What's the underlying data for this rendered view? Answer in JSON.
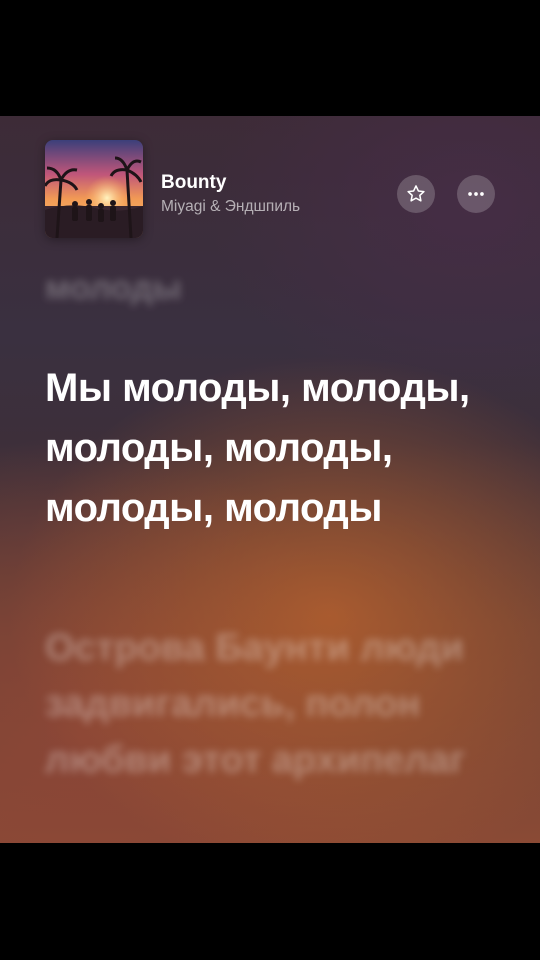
{
  "track": {
    "title": "Bounty",
    "artist": "Miyagi & Эндшпиль",
    "cover": "sunset-beach-party-artwork"
  },
  "actions": {
    "favorite_icon": "star-icon",
    "more_icon": "ellipsis-icon"
  },
  "lyrics": {
    "previous": "молоды",
    "current": "Мы молоды, молоды, молоды, молоды, молоды, молоды",
    "next": "Острова Баунти люди задвигались, полон любви этот архипелаг"
  },
  "colors": {
    "text_primary": "#ffffff",
    "button_bg": "rgba(255,255,255,0.2)"
  }
}
